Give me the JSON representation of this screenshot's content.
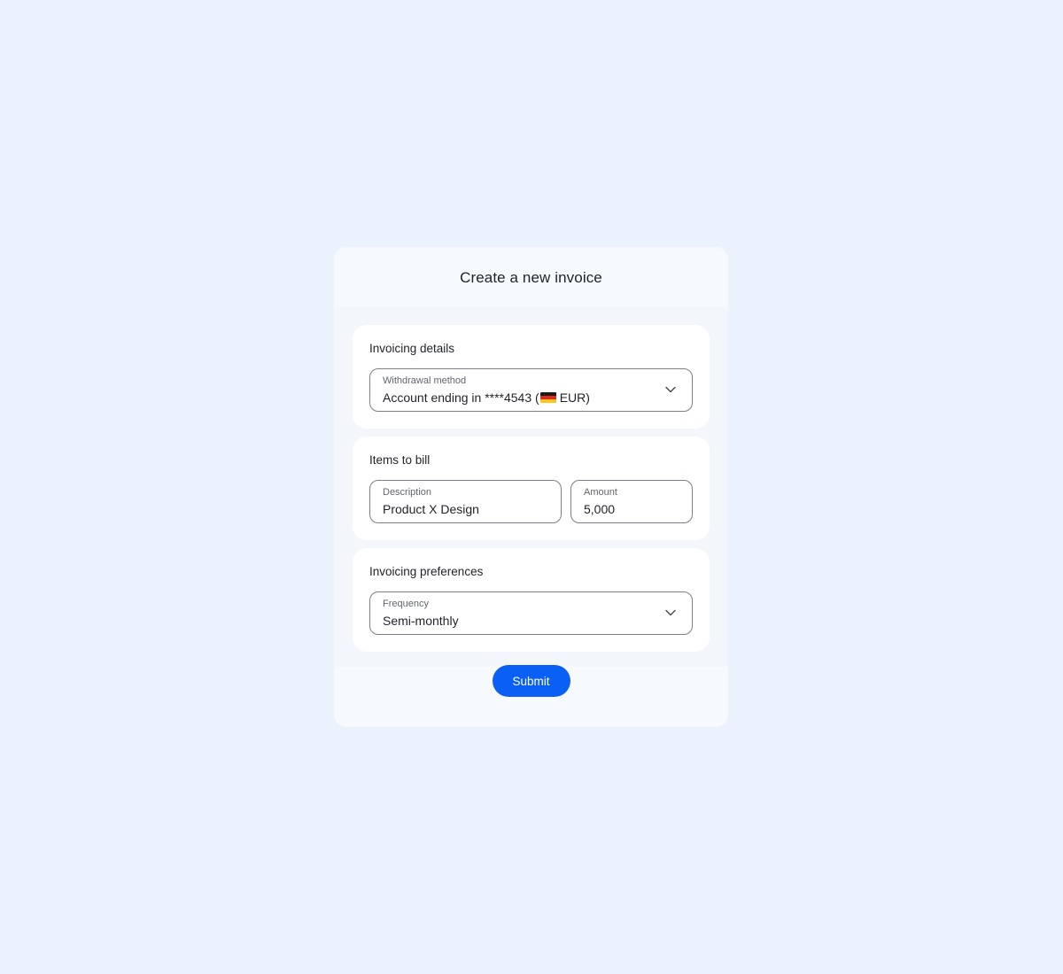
{
  "modal": {
    "title": "Create a new invoice"
  },
  "invoicing_details": {
    "title": "Invoicing details",
    "withdrawal_method": {
      "label": "Withdrawal method",
      "value_prefix": "Account ending in ****4543 (",
      "flag_icon": "germany-flag-icon",
      "value_suffix": "EUR)"
    }
  },
  "items_to_bill": {
    "title": "Items to bill",
    "description": {
      "label": "Description",
      "value": "Product X Design"
    },
    "amount": {
      "label": "Amount",
      "value": "5,000"
    }
  },
  "invoicing_preferences": {
    "title": "Invoicing preferences",
    "frequency": {
      "label": "Frequency",
      "value": "Semi-monthly"
    }
  },
  "footer": {
    "submit_label": "Submit"
  },
  "colors": {
    "background": "#ebf2fd",
    "accent": "#0a5ff5",
    "border": "#7b7f88"
  }
}
